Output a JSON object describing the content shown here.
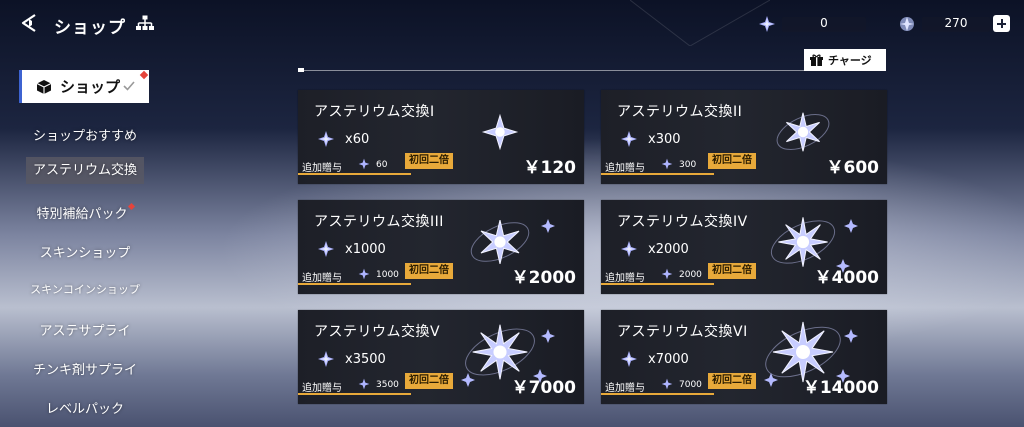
{
  "header": {
    "title": "ショップ",
    "currencies": [
      {
        "icon": "asterium-crystal-icon",
        "value": "0"
      },
      {
        "icon": "premium-crystal-icon",
        "value": "270"
      }
    ],
    "charge_label": "チャージ"
  },
  "sidebar": {
    "top_label": "ショップ",
    "items": [
      {
        "label": "ショップおすすめ",
        "active": false,
        "badge": false
      },
      {
        "label": "アステリウム交換",
        "active": true,
        "badge": false
      },
      {
        "label": "特別補給パック",
        "active": false,
        "badge": true
      },
      {
        "label": "スキンショップ",
        "active": false,
        "badge": false
      },
      {
        "label": "スキンコインショップ",
        "active": false,
        "badge": false
      },
      {
        "label": "アステサプライ",
        "active": false,
        "badge": false
      },
      {
        "label": "チンキ剤サプライ",
        "active": false,
        "badge": false
      },
      {
        "label": "レベルパック",
        "active": false,
        "badge": false
      }
    ]
  },
  "products": [
    {
      "title": "アステリウム交換I",
      "qty": "x60",
      "bonus_label": "追加贈与",
      "bonus": "60",
      "badge": "初回二倍",
      "price": "￥120"
    },
    {
      "title": "アステリウム交換II",
      "qty": "x300",
      "bonus_label": "追加贈与",
      "bonus": "300",
      "badge": "初回二倍",
      "price": "￥600"
    },
    {
      "title": "アステリウム交換III",
      "qty": "x1000",
      "bonus_label": "追加贈与",
      "bonus": "1000",
      "badge": "初回二倍",
      "price": "￥2000"
    },
    {
      "title": "アステリウム交換IV",
      "qty": "x2000",
      "bonus_label": "追加贈与",
      "bonus": "2000",
      "badge": "初回二倍",
      "price": "￥4000"
    },
    {
      "title": "アステリウム交換V",
      "qty": "x3500",
      "bonus_label": "追加贈与",
      "bonus": "3500",
      "badge": "初回二倍",
      "price": "￥7000"
    },
    {
      "title": "アステリウム交換VI",
      "qty": "x7000",
      "bonus_label": "追加贈与",
      "bonus": "7000",
      "badge": "初回二倍",
      "price": "￥14000"
    }
  ],
  "colors": {
    "accent_gold": "#e8a93a",
    "sidebar_marker": "#3d63d1",
    "new_badge": "#e5443b"
  }
}
